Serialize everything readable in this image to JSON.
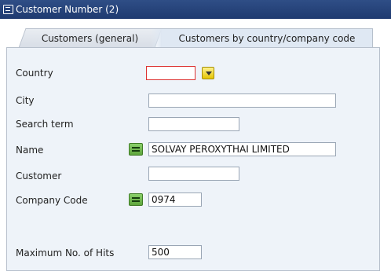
{
  "window": {
    "title": "Customer Number (2)"
  },
  "tabs": [
    {
      "label": "Customers (general)"
    },
    {
      "label": "Customers by country/company code"
    }
  ],
  "form": {
    "country": {
      "label": "Country",
      "value": ""
    },
    "city": {
      "label": "City",
      "value": ""
    },
    "search_term": {
      "label": "Search term",
      "value": ""
    },
    "name": {
      "label": "Name",
      "value": "SOLVAY PEROXYTHAI LIMITED"
    },
    "customer": {
      "label": "Customer",
      "value": ""
    },
    "company_code": {
      "label": "Company Code",
      "value": "0974"
    },
    "max_hits": {
      "label": "Maximum No. of Hits",
      "value": "500"
    }
  },
  "colors": {
    "titlebar": "#2f4e86",
    "panel": "#eef3f9",
    "required_border": "#dd3333",
    "green_button": "#6fbe4c"
  },
  "icons": {
    "title": "window-icon",
    "country_f4": "dropdown-f4-icon",
    "name_option": "selection-option-icon",
    "company_code_option": "selection-option-icon"
  }
}
